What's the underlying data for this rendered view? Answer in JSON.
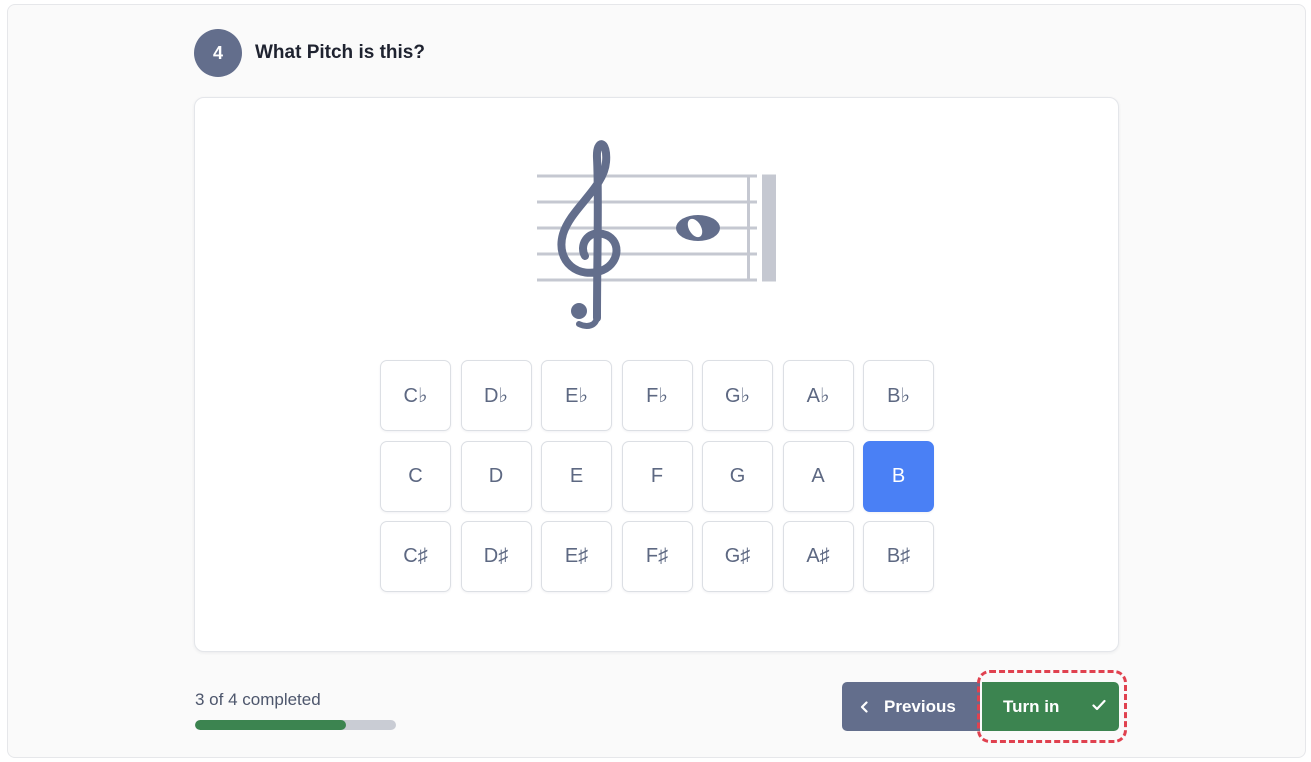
{
  "question": {
    "number": "4",
    "title": "What Pitch is this?"
  },
  "notation": {
    "clef": "treble-clef-icon",
    "note": "whole-note-icon",
    "ink_color": "#636e8c",
    "staff_color": "#c5c8d1"
  },
  "pitch_keys": {
    "flats": [
      "C♭",
      "D♭",
      "E♭",
      "F♭",
      "G♭",
      "A♭",
      "B♭"
    ],
    "naturals": [
      "C",
      "D",
      "E",
      "F",
      "G",
      "A",
      "B"
    ],
    "sharps": [
      "C♯",
      "D♯",
      "E♯",
      "F♯",
      "G♯",
      "A♯",
      "B♯"
    ],
    "selected": "B",
    "selected_color": "#4a80f5"
  },
  "progress": {
    "text": "3 of 4 completed",
    "completed": 3,
    "total": 4,
    "fill_color": "#3c8450"
  },
  "buttons": {
    "previous_label": "Previous",
    "previous_icon": "chevron-left-icon",
    "turn_in_label": "Turn in",
    "turn_in_icon": "check-icon",
    "turn_in_color": "#3c8450",
    "highlight_color": "#e0414f"
  }
}
